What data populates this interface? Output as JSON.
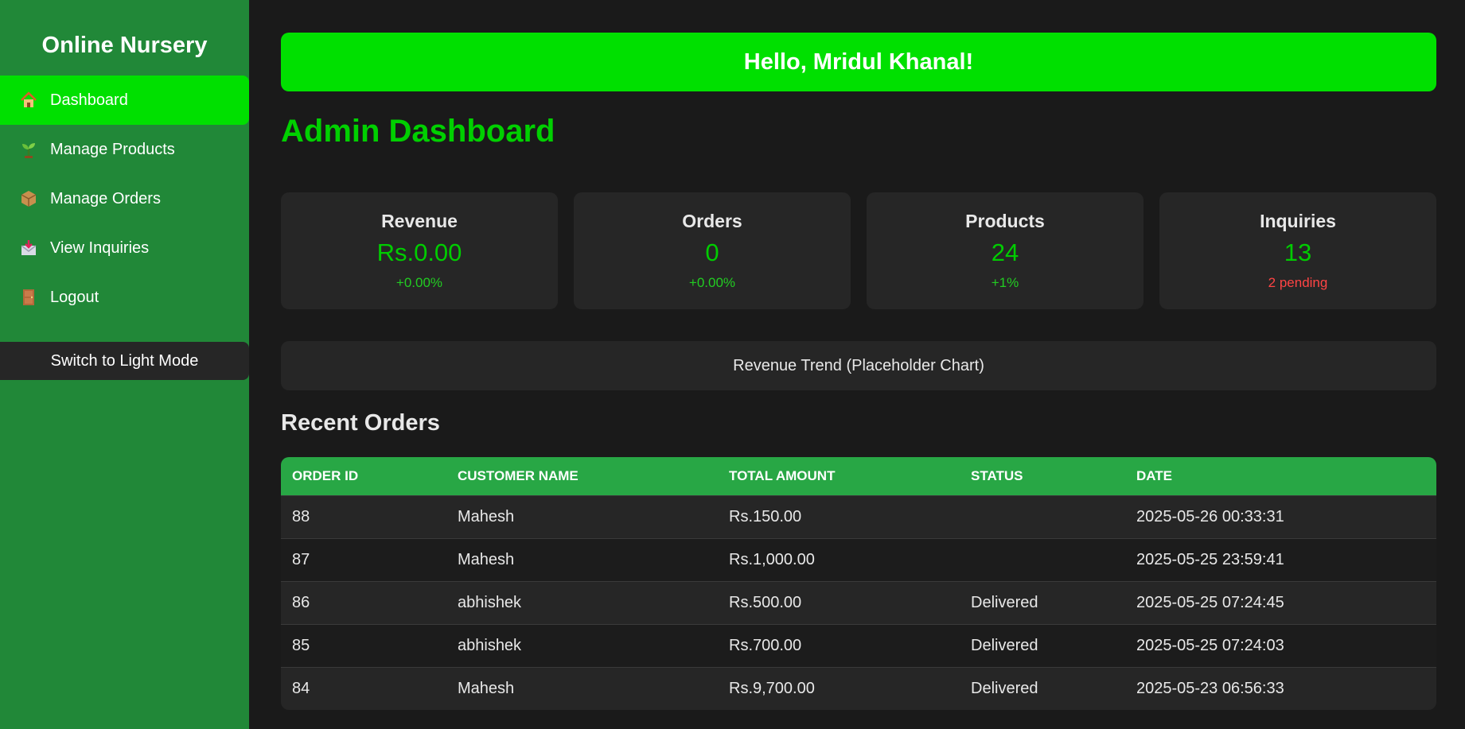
{
  "sidebar": {
    "brand": "Online Nursery",
    "items": [
      {
        "label": "Dashboard",
        "icon": "house-icon",
        "active": true
      },
      {
        "label": "Manage Products",
        "icon": "seedling-icon",
        "active": false
      },
      {
        "label": "Manage Orders",
        "icon": "package-icon",
        "active": false
      },
      {
        "label": "View Inquiries",
        "icon": "inbox-icon",
        "active": false
      },
      {
        "label": "Logout",
        "icon": "door-icon",
        "active": false
      }
    ],
    "theme_button": "Switch to Light Mode"
  },
  "header": {
    "greeting": "Hello, Mridul Khanal!"
  },
  "page_title": "Admin Dashboard",
  "stats": [
    {
      "label": "Revenue",
      "value": "Rs.0.00",
      "sub": "+0.00%"
    },
    {
      "label": "Orders",
      "value": "0",
      "sub": "+0.00%"
    },
    {
      "label": "Products",
      "value": "24",
      "sub": "+1%"
    },
    {
      "label": "Inquiries",
      "value": "13",
      "sub": "2 pending"
    }
  ],
  "chart_placeholder": "Revenue Trend (Placeholder Chart)",
  "recent_orders": {
    "title": "Recent Orders",
    "columns": [
      "Order ID",
      "Customer Name",
      "Total Amount",
      "Status",
      "Date"
    ],
    "rows": [
      [
        "88",
        "Mahesh",
        "Rs.150.00",
        "",
        "2025-05-26 00:33:31"
      ],
      [
        "87",
        "Mahesh",
        "Rs.1,000.00",
        "",
        "2025-05-25 23:59:41"
      ],
      [
        "86",
        "abhishek",
        "Rs.500.00",
        "Delivered",
        "2025-05-25 07:24:45"
      ],
      [
        "85",
        "abhishek",
        "Rs.700.00",
        "Delivered",
        "2025-05-25 07:24:03"
      ],
      [
        "84",
        "Mahesh",
        "Rs.9,700.00",
        "Delivered",
        "2025-05-23 06:56:33"
      ]
    ]
  },
  "colors": {
    "sidebar_bg": "#218838",
    "accent": "#00e000",
    "table_header": "#28a745",
    "positive": "#22cc22",
    "warning": "#ff4444",
    "page_bg": "#1a1a1a",
    "card_bg": "#262626"
  }
}
